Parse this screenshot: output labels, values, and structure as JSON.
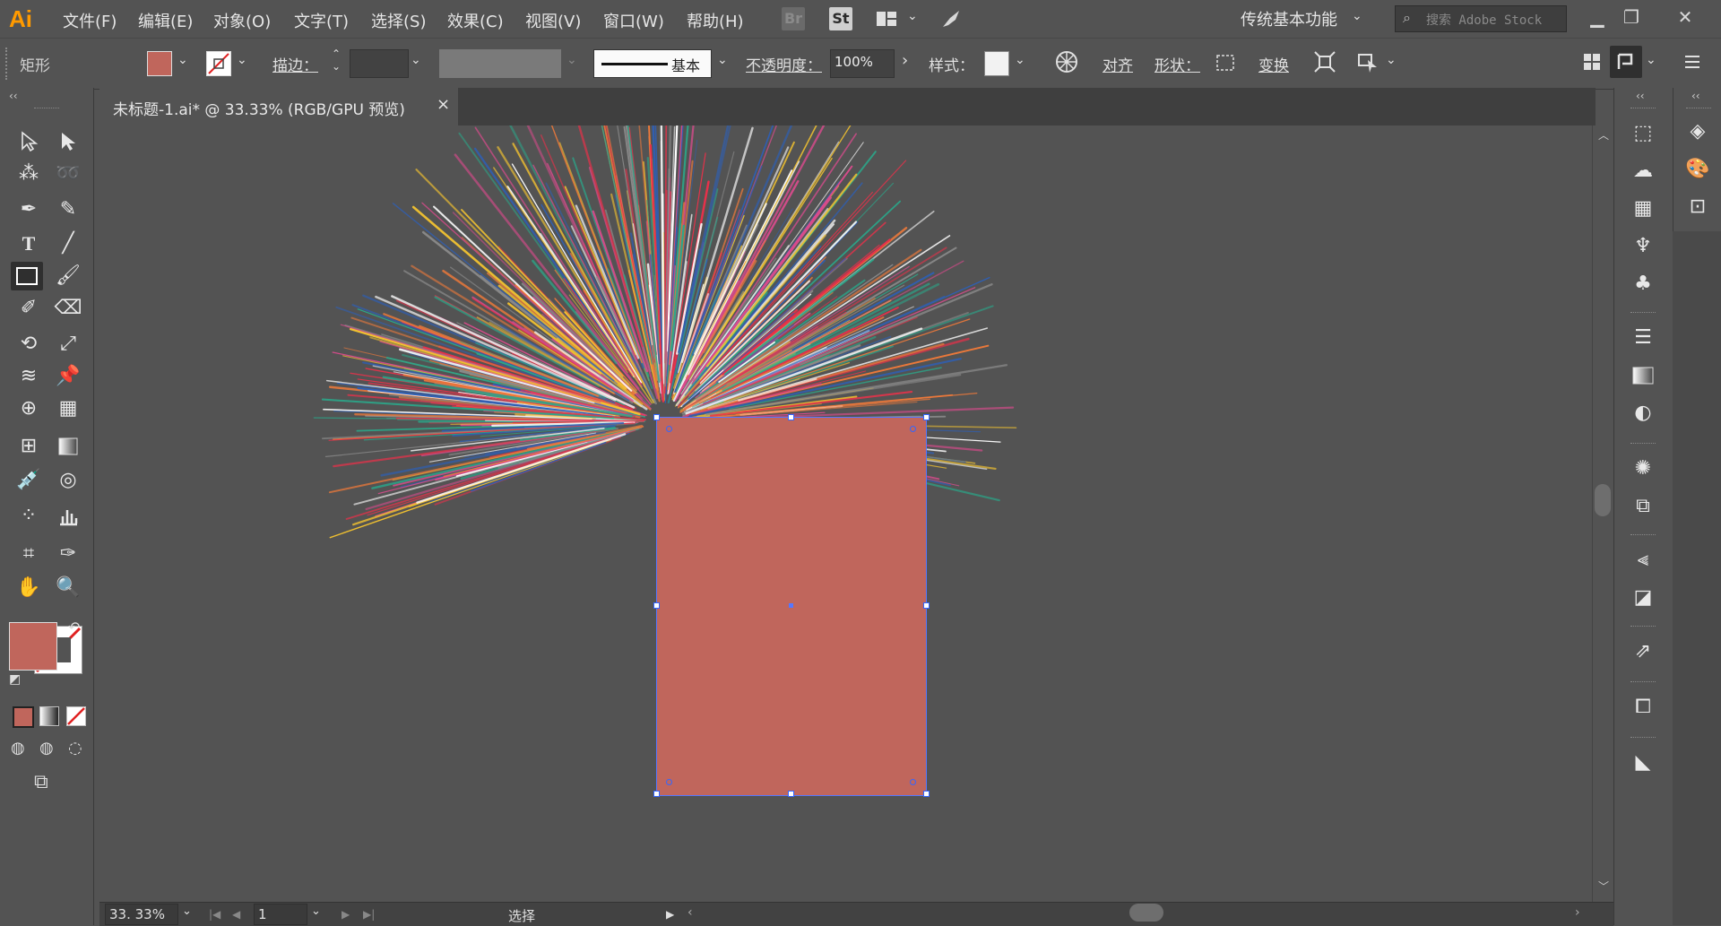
{
  "app": {
    "logo_text": "Ai",
    "logo_color": "#ff9a00"
  },
  "menu": {
    "items": [
      "文件(F)",
      "编辑(E)",
      "对象(O)",
      "文字(T)",
      "选择(S)",
      "效果(C)",
      "视图(V)",
      "窗口(W)",
      "帮助(H)"
    ],
    "bridge_label": "Br",
    "stock_label": "St"
  },
  "workspace": {
    "label": "传统基本功能"
  },
  "search": {
    "placeholder": "搜索 Adobe Stock"
  },
  "control_bar": {
    "object_type": "矩形",
    "fill_color": "#c0665c",
    "stroke_label": "描边：",
    "brush_preset": "基本",
    "opacity_label": "不透明度：",
    "opacity_value": "100%",
    "style_label": "样式：",
    "align_label": "对齐",
    "shape_label": "形状：",
    "transform_label": "变换"
  },
  "document": {
    "tab_title": "未标题-1.ai* @ 33.33% (RGB/GPU 预览)",
    "close_symbol": "×"
  },
  "status_bar": {
    "zoom": "33. 33%",
    "artboard_number": "1",
    "tool_status": "选择"
  },
  "toolbox": {
    "fill_color": "#c0665c",
    "stroke_color": "none"
  },
  "artwork": {
    "rectangle_fill": "#c0665c",
    "burst_colors": [
      "#e8314a",
      "#f2c230",
      "#2f5fb3",
      "#f07a3a",
      "#2aa88a",
      "#d84b8c",
      "#ffffff",
      "#8a8a8a"
    ]
  }
}
